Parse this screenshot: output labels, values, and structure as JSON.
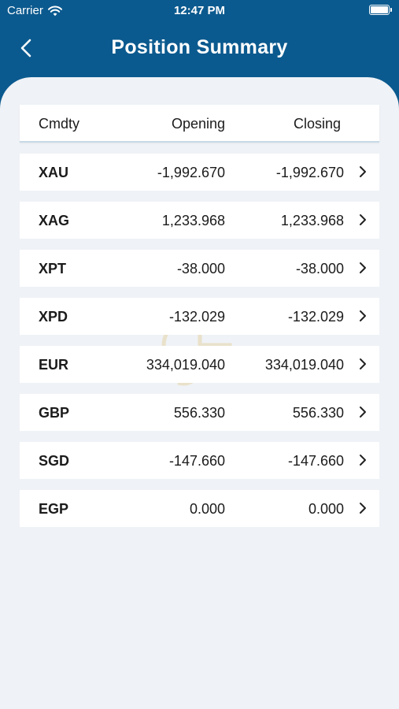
{
  "status_bar": {
    "carrier": "Carrier",
    "time": "12:47 PM"
  },
  "nav": {
    "title": "Position Summary"
  },
  "table": {
    "headers": {
      "code": "Cmdty",
      "opening": "Opening",
      "closing": "Closing"
    },
    "rows": [
      {
        "code": "XAU",
        "opening": "-1,992.670",
        "closing": "-1,992.670"
      },
      {
        "code": "XAG",
        "opening": "1,233.968",
        "closing": "1,233.968"
      },
      {
        "code": "XPT",
        "opening": "-38.000",
        "closing": "-38.000"
      },
      {
        "code": "XPD",
        "opening": "-132.029",
        "closing": "-132.029"
      },
      {
        "code": "EUR",
        "opening": "334,019.040",
        "closing": "334,019.040"
      },
      {
        "code": "GBP",
        "opening": "556.330",
        "closing": "556.330"
      },
      {
        "code": "SGD",
        "opening": "-147.660",
        "closing": "-147.660"
      },
      {
        "code": "EGP",
        "opening": "0.000",
        "closing": "0.000"
      }
    ]
  },
  "colors": {
    "brand": "#0b5a8f",
    "background": "#eff2f6",
    "watermark": "#d9b24a"
  },
  "icons": [
    "wifi-icon",
    "battery-icon",
    "back-chevron-icon",
    "row-chevron-icon",
    "watermark-logo"
  ]
}
